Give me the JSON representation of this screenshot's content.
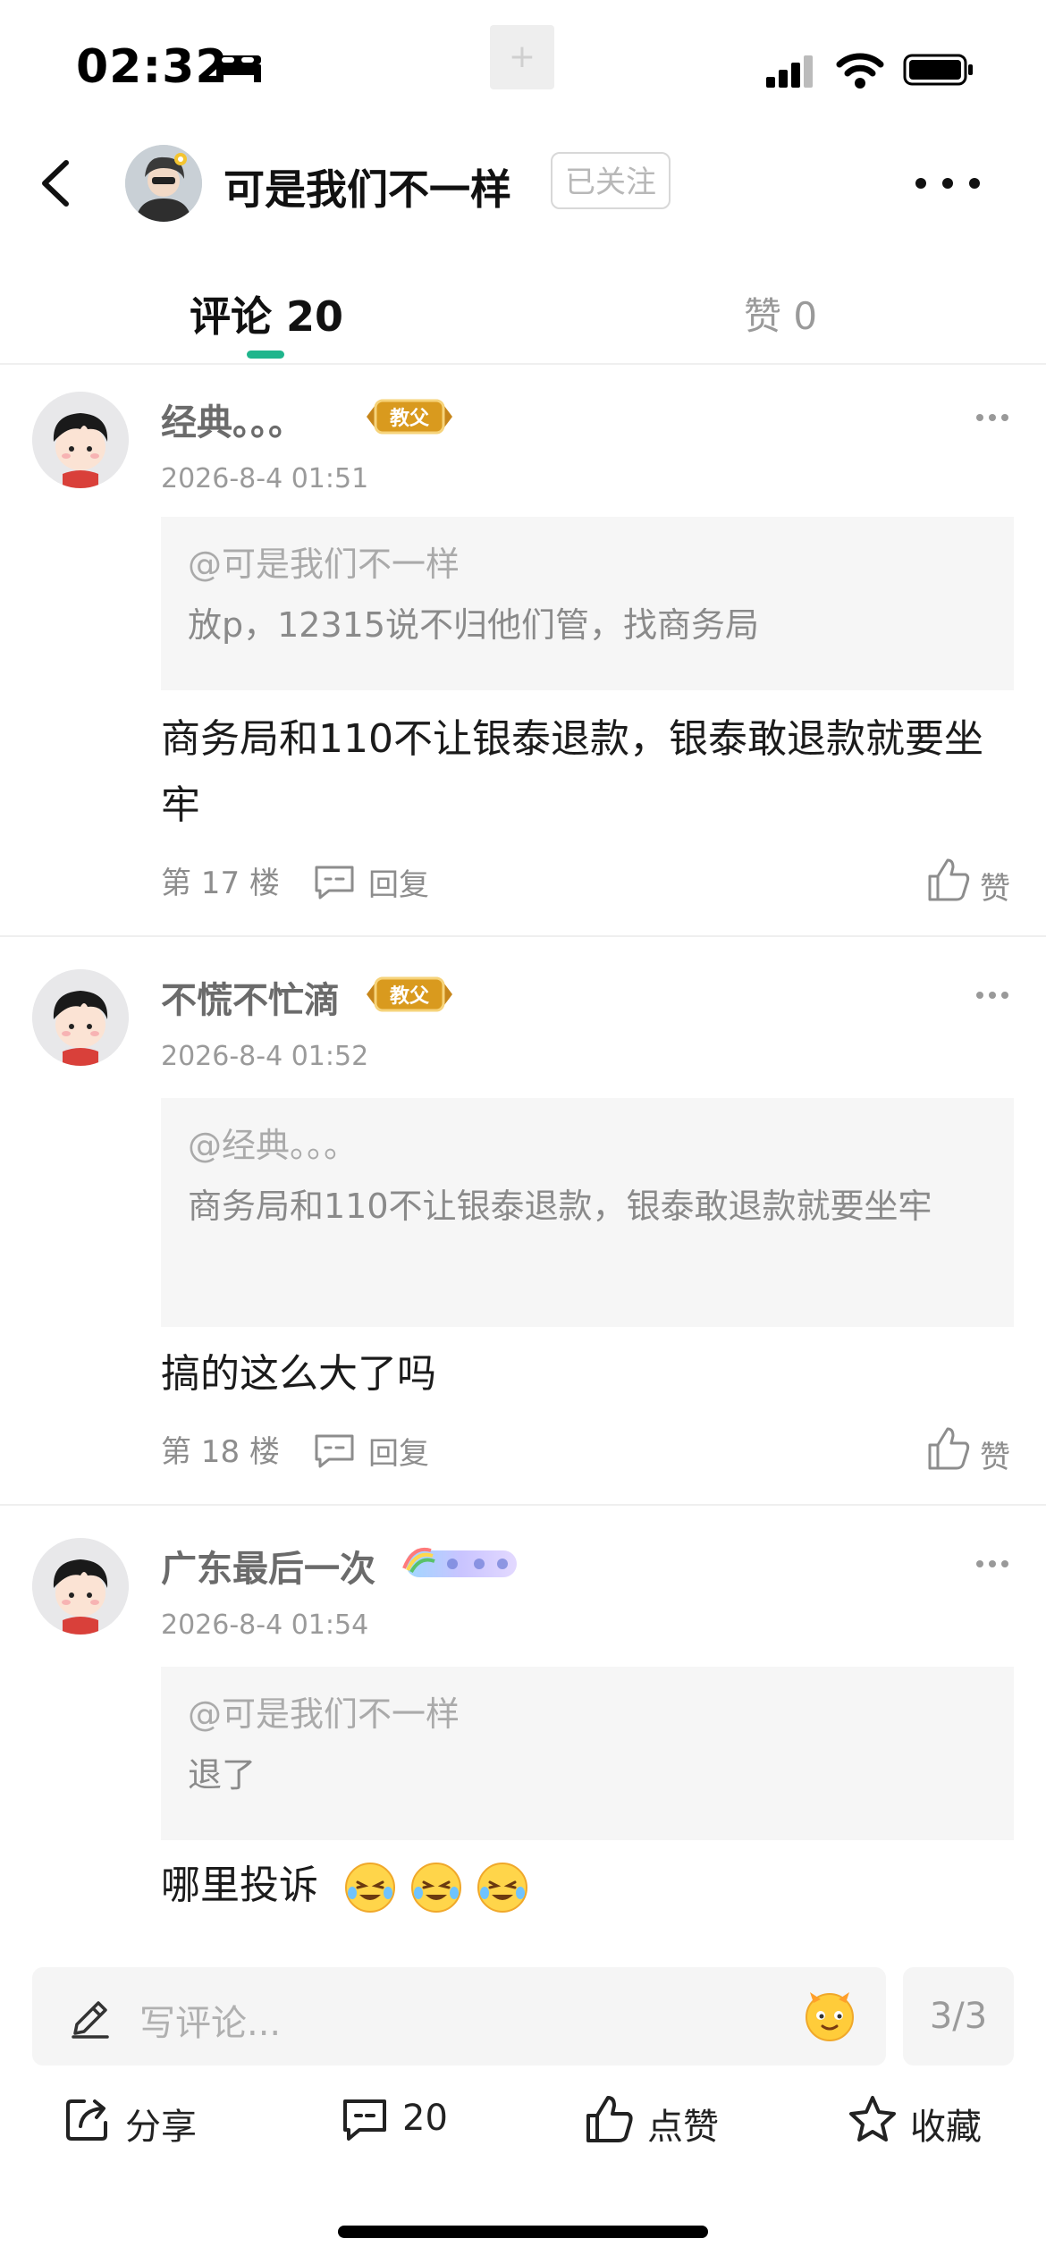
{
  "status_bar": {
    "time": "02:32"
  },
  "header": {
    "user_name": "可是我们不一样",
    "follow_status": "已关注"
  },
  "tabs": {
    "comments_label": "评论 20",
    "likes_label": "赞 0"
  },
  "comments": [
    {
      "name": "经典。。。",
      "badge_text": "教父",
      "time": "2026-8-4 01:51",
      "quote_mention": "@可是我们不一样",
      "quote_text": "放p，12315说不归他们管，找商务局",
      "body": "商务局和110不让银泰退款，银泰敢退款就要坐牢",
      "floor": "第 17 楼",
      "reply_label": "回复",
      "like_label": "赞"
    },
    {
      "name": "不慌不忙滴",
      "badge_text": "教父",
      "time": "2026-8-4 01:52",
      "quote_mention": "@经典。。。",
      "quote_text": "商务局和110不让银泰退款，银泰敢退款就要坐牢",
      "body": "搞的这么大了吗",
      "floor": "第 18 楼",
      "reply_label": "回复",
      "like_label": "赞"
    },
    {
      "name": "广东最后一次",
      "time": "2026-8-4 01:54",
      "quote_mention": "@可是我们不一样",
      "quote_text": "退了",
      "body": "哪里投诉",
      "emoji_count": 3
    }
  ],
  "bottom": {
    "input_placeholder": "写评论...",
    "page_indicator": "3/3",
    "share_label": "分享",
    "comment_count": "20",
    "like_label": "点赞",
    "favorite_label": "收藏"
  },
  "colors": {
    "accent": "#1fb58c",
    "badge_gold": "#d99a1e"
  }
}
